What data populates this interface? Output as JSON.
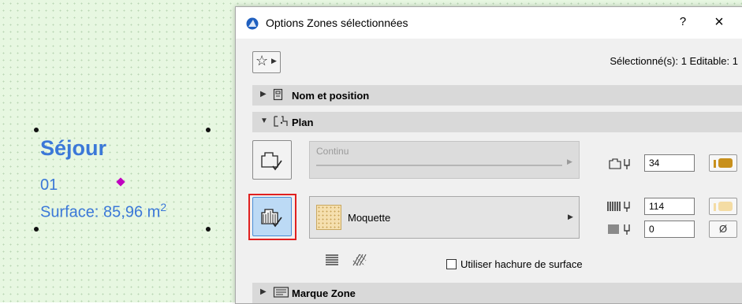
{
  "canvas": {
    "zone_name": "Séjour",
    "zone_number": "01",
    "zone_surface": "Surface: 85,96 m",
    "zone_surface_exp": "2"
  },
  "dialog": {
    "title": "Options Zones sélectionnées",
    "help_label": "?",
    "close_label": "×",
    "selection_info": "Sélectionné(s): 1 Editable: 1",
    "favorites_icon": "star-icon",
    "sections": {
      "name_position": "Nom et position",
      "plan": "Plan",
      "zone_stamp": "Marque Zone"
    },
    "plan": {
      "line_type": "Continu",
      "contour_pen": "34",
      "fill_name": "Moquette",
      "fill_pen": "114",
      "background_pen": "0",
      "background_symbol": "Ø",
      "use_surface_hatch_label": "Utiliser hachure de surface",
      "use_surface_hatch_checked": false
    },
    "colors": {
      "pen_34": "#c8901c",
      "pen_114": "#f4dca4",
      "zone_text": "#3b78d8",
      "highlight_frame": "#e02020"
    }
  }
}
